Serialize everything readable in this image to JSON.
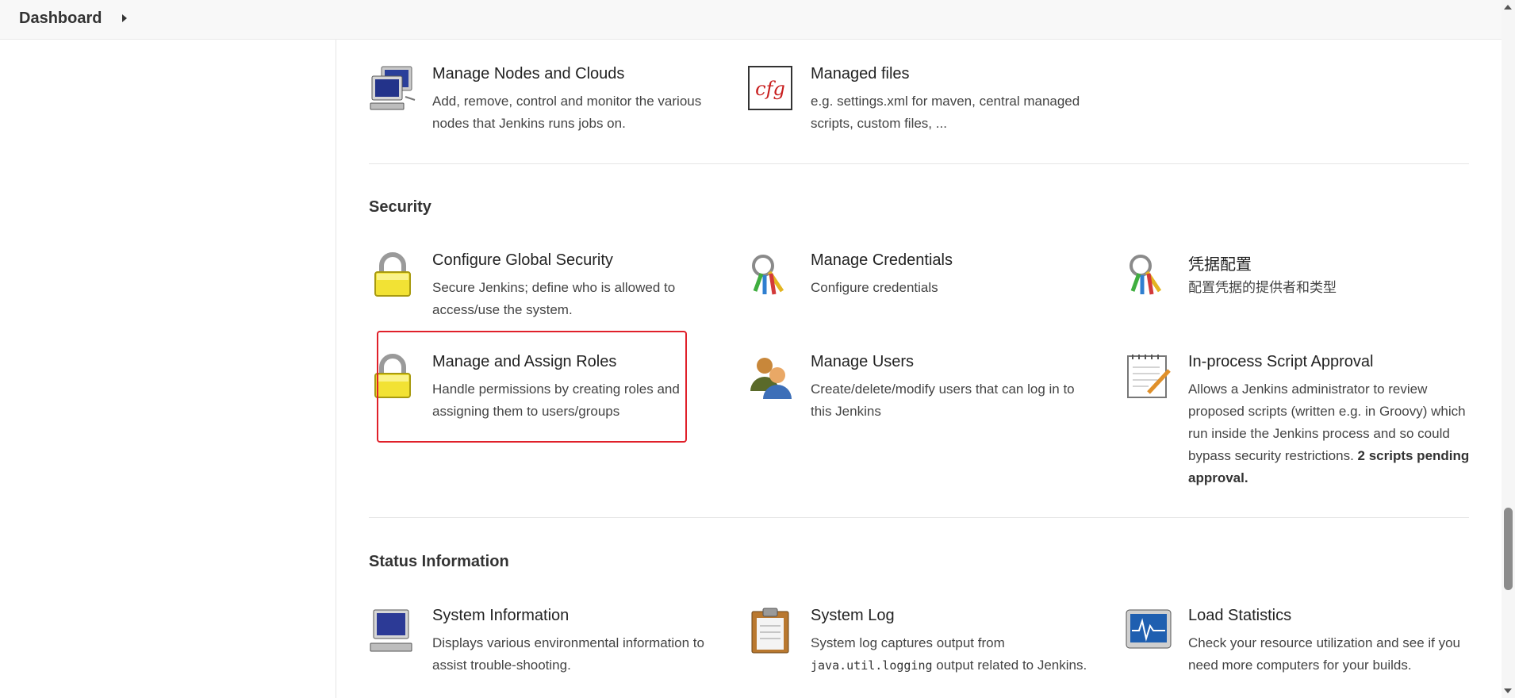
{
  "breadcrumb": {
    "label": "Dashboard"
  },
  "sections": {
    "top": {
      "tiles": {
        "nodes": {
          "title": "Manage Nodes and Clouds",
          "desc": "Add, remove, control and monitor the various nodes that Jenkins runs jobs on."
        },
        "files": {
          "title": "Managed files",
          "desc": "e.g. settings.xml for maven, central managed scripts, custom files, ...",
          "icon_text": "cfg"
        }
      }
    },
    "security": {
      "title": "Security",
      "tiles": {
        "global_security": {
          "title": "Configure Global Security",
          "desc": "Secure Jenkins; define who is allowed to access/use the system."
        },
        "credentials": {
          "title": "Manage Credentials",
          "desc": "Configure credentials"
        },
        "credential_config": {
          "title": "凭据配置",
          "desc": "配置凭据的提供者和类型"
        },
        "roles": {
          "title": "Manage and Assign Roles",
          "desc": "Handle permissions by creating roles and assigning them to users/groups"
        },
        "users": {
          "title": "Manage Users",
          "desc": "Create/delete/modify users that can log in to this Jenkins"
        },
        "script_approval": {
          "title": "In-process Script Approval",
          "desc": "Allows a Jenkins administrator to review proposed scripts (written e.g. in Groovy) which run inside the Jenkins process and so could bypass security restrictions.",
          "pending": "2 scripts pending approval."
        }
      }
    },
    "status": {
      "title": "Status Information",
      "tiles": {
        "system_info": {
          "title": "System Information",
          "desc": "Displays various environmental information to assist trouble-shooting."
        },
        "system_log": {
          "title": "System Log",
          "desc_pre": "System log captures output from",
          "desc_code": "java.util.logging",
          "desc_post": "output related to Jenkins."
        },
        "load_stats": {
          "title": "Load Statistics",
          "desc": "Check your resource utilization and see if you need more computers for your builds."
        }
      }
    }
  },
  "colors": {
    "highlight": "#e0202a",
    "lock": "#f2e234",
    "cfg": "#c81e1e"
  }
}
